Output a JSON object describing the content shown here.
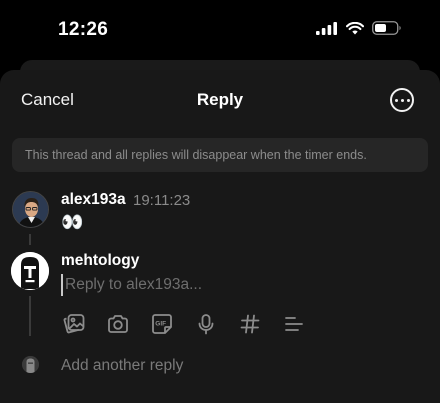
{
  "status_bar": {
    "time": "12:26",
    "icons": [
      "signal-icon",
      "wifi-icon",
      "battery-icon"
    ]
  },
  "header": {
    "cancel_label": "Cancel",
    "title": "Reply",
    "more_icon": "more-icon"
  },
  "notice": {
    "text": "This thread and all replies will disappear when the timer ends."
  },
  "post": {
    "username": "alex193a",
    "timestamp": "19:11:23",
    "text": "👀"
  },
  "reply": {
    "username": "mehtology",
    "placeholder": "Reply to alex193a...",
    "value": "",
    "tools": [
      "gallery-icon",
      "camera-icon",
      "gif-icon",
      "microphone-icon",
      "hashtag-icon",
      "poll-icon"
    ]
  },
  "add_another": {
    "label": "Add another reply"
  },
  "colors": {
    "background": "#000000",
    "sheet": "#181818",
    "notice_bg": "#262626",
    "muted_text": "#8a8a8a",
    "primary_text": "#f2f2f2"
  }
}
